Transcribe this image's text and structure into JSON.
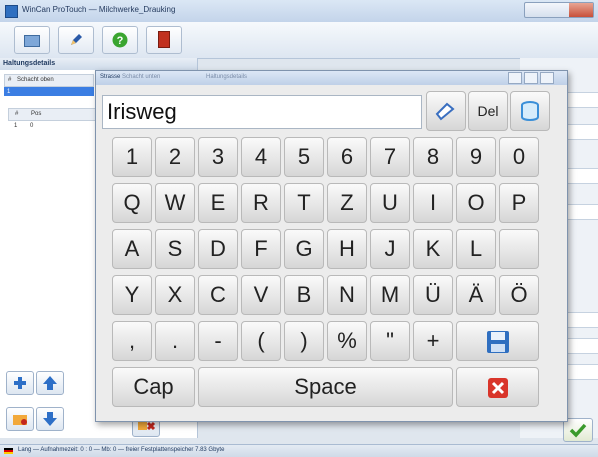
{
  "window": {
    "title": "WinCan ProTouch — Milchwerke_Drauking"
  },
  "left_panel": {
    "title": "Haltungsdetails",
    "top_grid": {
      "headers": [
        "#",
        "Schacht oben"
      ],
      "rows": [
        [
          "1",
          ""
        ]
      ]
    },
    "sub_grid": {
      "headers": [
        "#",
        "Pos"
      ],
      "rows": [
        [
          "1",
          "0"
        ]
      ]
    }
  },
  "keyboard": {
    "title": "Strasse",
    "title_tab_1": "Schacht unten",
    "title_tab_2": "Haltungsdetails",
    "input_value": "Irisweg",
    "del_label": "Del",
    "rows": [
      [
        "1",
        "2",
        "3",
        "4",
        "5",
        "6",
        "7",
        "8",
        "9",
        "0"
      ],
      [
        "Q",
        "W",
        "E",
        "R",
        "T",
        "Z",
        "U",
        "I",
        "O",
        "P"
      ],
      [
        "A",
        "S",
        "D",
        "F",
        "G",
        "H",
        "J",
        "K",
        "L",
        ""
      ],
      [
        "Y",
        "X",
        "C",
        "V",
        "B",
        "N",
        "M",
        "Ü",
        "Ä",
        "Ö"
      ],
      [
        ",",
        ".",
        "-",
        "(",
        ")",
        "%",
        "\"",
        "+"
      ]
    ],
    "cap_label": "Cap",
    "space_label": "Space"
  },
  "status_bar": {
    "text": "Lang — Aufnahmezeit: 0 : 0 — Mb: 0 — freier Festplattenspeicher 7.83 Gbyte"
  },
  "colors": {
    "accent_blue": "#3b7ee3",
    "close_red": "#d9352a",
    "ok_green": "#3a9a2c"
  }
}
